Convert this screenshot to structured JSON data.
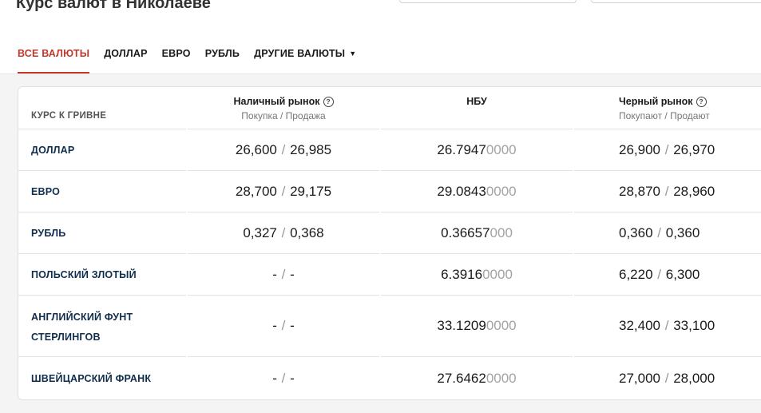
{
  "page": {
    "title": "Курс валют в Николаеве"
  },
  "tabs": [
    {
      "label": "ВСЕ ВАЛЮТЫ",
      "active": true
    },
    {
      "label": "ДОЛЛАР"
    },
    {
      "label": "ЕВРО"
    },
    {
      "label": "РУБЛЬ"
    },
    {
      "label": "ДРУГИЕ ВАЛЮТЫ",
      "caret": "▼"
    }
  ],
  "table": {
    "corner_label": "КУРС К ГРИВНЕ",
    "columns": [
      {
        "title": "Наличный рынок",
        "sub": "Покупка / Продажа",
        "help": "?"
      },
      {
        "title": "НБУ",
        "sub": ""
      },
      {
        "title": "Черный рынок",
        "sub": "Покупают / Продают",
        "help": "?"
      }
    ],
    "slash": "/",
    "rows": [
      {
        "name": "ДОЛЛАР",
        "cash_buy": "26,600",
        "cash_sell": "26,985",
        "nbu_main": "26.7947",
        "nbu_tail": "0000",
        "black_buy": "26,900",
        "black_sell": "26,970"
      },
      {
        "name": "ЕВРО",
        "cash_buy": "28,700",
        "cash_sell": "29,175",
        "nbu_main": "29.0843",
        "nbu_tail": "0000",
        "black_buy": "28,870",
        "black_sell": "28,960"
      },
      {
        "name": "РУБЛЬ",
        "cash_buy": "0,327",
        "cash_sell": "0,368",
        "nbu_main": "0.36657",
        "nbu_tail": "000",
        "black_buy": "0,360",
        "black_sell": "0,360"
      },
      {
        "name": "ПОЛЬСКИЙ ЗЛОТЫЙ",
        "cash_buy": "-",
        "cash_sell": "-",
        "nbu_main": "6.3916",
        "nbu_tail": "0000",
        "black_buy": "6,220",
        "black_sell": "6,300"
      },
      {
        "name_line1": "АНГЛИЙСКИЙ ФУНТ",
        "name_line2": "СТЕРЛИНГОВ",
        "cash_buy": "-",
        "cash_sell": "-",
        "nbu_main": "33.1209",
        "nbu_tail": "0000",
        "black_buy": "32,400",
        "black_sell": "33,100"
      },
      {
        "name": "ШВЕЙЦАРСКИЙ ФРАНК",
        "cash_buy": "-",
        "cash_sell": "-",
        "nbu_main": "27.6462",
        "nbu_tail": "0000",
        "black_buy": "27,000",
        "black_sell": "28,000"
      }
    ]
  }
}
